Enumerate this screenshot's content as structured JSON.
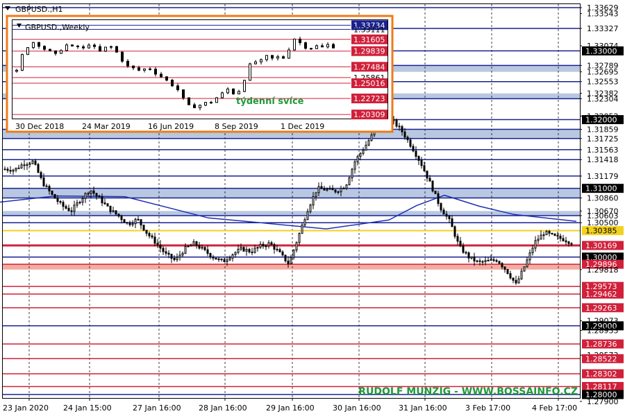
{
  "title": "GBPUSD.,H1",
  "watermark": "RUDOLF MUNZIG - WWW.BOSSAINFO.CZ",
  "colors": {
    "background": "#ffffff",
    "frame": "#000000",
    "ma": "#1f2fb4",
    "candle_up": "#ffffff",
    "candle_down": "#000000",
    "bg_zone": "#b8c8e0",
    "red_zone": "#f4aca0",
    "watermark": "#1e9a3a",
    "inset_border": "#f07a18"
  },
  "price_axis": {
    "min": 1.2795,
    "max": 1.3368,
    "tick_labels": [
      "1.33629",
      "1.33543",
      "1.33327",
      "1.33074",
      "1.33000",
      "1.32789",
      "1.32695",
      "1.32553",
      "1.32382",
      "1.32304",
      "1.32052",
      "1.32000",
      "1.31859",
      "1.31725",
      "1.31563",
      "1.31418",
      "1.31179",
      "1.31000",
      "1.30860",
      "1.30670",
      "1.30603",
      "1.30500",
      "1.30385",
      "1.30169",
      "1.30000",
      "1.29896",
      "1.29818",
      "1.29573",
      "1.29462",
      "1.29263",
      "1.29073",
      "1.29000",
      "1.28933",
      "1.28736",
      "1.28573",
      "1.28522",
      "1.28302",
      "1.28117",
      "1.28000",
      "1.27900"
    ]
  },
  "time_axis": {
    "labels": [
      "23 Jan 2020",
      "24 Jan 15:00",
      "27 Jan 16:00",
      "28 Jan 16:00",
      "29 Jan 16:00",
      "30 Jan 16:00",
      "31 Jan 16:00",
      "3 Feb 17:00",
      "4 Feb 17:00"
    ]
  },
  "chart_data": {
    "type": "candlestick",
    "symbol": "GBPUSD.",
    "timeframe": "H1",
    "ylim": [
      1.2795,
      1.3368
    ],
    "x_labels": [
      "23 Jan 2020",
      "24 Jan 15:00",
      "27 Jan 16:00",
      "28 Jan 16:00",
      "29 Jan 16:00",
      "30 Jan 16:00",
      "31 Jan 16:00",
      "3 Feb 17:00",
      "4 Feb 17:00"
    ],
    "price_path": [
      1.3128,
      1.3127,
      1.3136,
      1.3139,
      1.3108,
      1.309,
      1.3075,
      1.3067,
      1.3084,
      1.3098,
      1.3085,
      1.307,
      1.306,
      1.3048,
      1.3055,
      1.3035,
      1.302,
      1.3004,
      1.2995,
      1.3012,
      1.302,
      1.301,
      1.3,
      1.2993,
      1.3004,
      1.3012,
      1.3008,
      1.3016,
      1.302,
      1.3006,
      1.299,
      1.303,
      1.307,
      1.31,
      1.3098,
      1.3096,
      1.3104,
      1.314,
      1.316,
      1.3182,
      1.32,
      1.3198,
      1.3182,
      1.316,
      1.3135,
      1.3105,
      1.3072,
      1.3052,
      1.3015,
      1.3,
      1.2992,
      1.2994,
      1.2996,
      1.298,
      1.296,
      1.299,
      1.3022,
      1.3036,
      1.303,
      1.3026,
      1.302
    ],
    "moving_average": [
      [
        0,
        1.308
      ],
      [
        80,
        1.3089
      ],
      [
        180,
        1.3088
      ],
      [
        300,
        1.3057
      ],
      [
        470,
        1.3041
      ],
      [
        560,
        1.3054
      ],
      [
        600,
        1.3075
      ],
      [
        640,
        1.309
      ],
      [
        690,
        1.3074
      ],
      [
        740,
        1.3062
      ],
      [
        830,
        1.3052
      ]
    ],
    "zones": [
      {
        "from": 1.32695,
        "to": 1.32789,
        "color": "bg_zone"
      },
      {
        "from": 1.32304,
        "to": 1.32382,
        "color": "bg_zone"
      },
      {
        "from": 1.31725,
        "to": 1.31859,
        "color": "bg_zone"
      },
      {
        "from": 1.3086,
        "to": 1.31,
        "color": "bg_zone"
      },
      {
        "from": 1.30603,
        "to": 1.3067,
        "color": "bg_zone"
      },
      {
        "from": 1.29818,
        "to": 1.29896,
        "color": "red_zone"
      }
    ],
    "levels": [
      {
        "price": 1.33629,
        "label": "1.33629",
        "color": "#1a2090",
        "badge": false
      },
      {
        "price": 1.33327,
        "label": "1.33327",
        "color": "#1a2090",
        "badge": false
      },
      {
        "price": 1.33,
        "label": "1.33000",
        "color": "#1a2090",
        "badge": true
      },
      {
        "price": 1.32789,
        "label": "1.32789",
        "color": "#1a2090",
        "badge": false
      },
      {
        "price": 1.32553,
        "label": "1.32553",
        "color": "#1a2090",
        "badge": false
      },
      {
        "price": 1.32304,
        "label": "1.32304",
        "color": "#1a2090",
        "badge": false
      },
      {
        "price": 1.32,
        "label": "1.32000",
        "color": "#1a2090",
        "badge": true
      },
      {
        "price": 1.31859,
        "label": "1.31859",
        "color": "#1a2090",
        "badge": false
      },
      {
        "price": 1.31725,
        "label": "1.31725",
        "color": "#1a2090",
        "badge": false
      },
      {
        "price": 1.31563,
        "label": "1.31563",
        "color": "#1a2090",
        "badge": false
      },
      {
        "price": 1.31418,
        "label": "1.31418",
        "color": "#1a2090",
        "badge": false
      },
      {
        "price": 1.31179,
        "label": "1.31179",
        "color": "#1a2090",
        "badge": false
      },
      {
        "price": 1.31,
        "label": "1.31000",
        "color": "#1a2090",
        "badge": true
      },
      {
        "price": 1.3086,
        "label": "1.30860",
        "color": "#1a2090",
        "badge": false
      },
      {
        "price": 1.30603,
        "label": "1.30603",
        "color": "#1a2090",
        "badge": false
      },
      {
        "price": 1.305,
        "label": "1.30500",
        "color": "#1a2090",
        "badge": false
      },
      {
        "price": 1.30385,
        "label": "1.30385",
        "color": "#f3d11f",
        "badge": false
      },
      {
        "price": 1.30169,
        "label": "1.30169",
        "color": "#d0203a",
        "badge": false
      },
      {
        "price": 1.3,
        "label": "1.30000",
        "color": "#1a2090",
        "badge": true
      },
      {
        "price": 1.29896,
        "label": "1.29896",
        "color": "#d0203a",
        "badge": false
      },
      {
        "price": 1.29573,
        "label": "1.29573",
        "color": "#d0203a",
        "badge": false
      },
      {
        "price": 1.29462,
        "label": "1.29462",
        "color": "#d0203a",
        "badge": false
      },
      {
        "price": 1.29263,
        "label": "1.29263",
        "color": "#d0203a",
        "badge": false
      },
      {
        "price": 1.29,
        "label": "1.29000",
        "color": "#1a2090",
        "badge": true
      },
      {
        "price": 1.28736,
        "label": "1.28736",
        "color": "#d0203a",
        "badge": false
      },
      {
        "price": 1.28522,
        "label": "1.28522",
        "color": "#d0203a",
        "badge": false
      },
      {
        "price": 1.28302,
        "label": "1.28302",
        "color": "#d0203a",
        "badge": false
      },
      {
        "price": 1.28117,
        "label": "1.28117",
        "color": "#d0203a",
        "badge": false
      },
      {
        "price": 1.28,
        "label": "1.28000",
        "color": "#1a2090",
        "badge": true
      }
    ],
    "inset": {
      "title": "GBPUSD.,Weekly",
      "annotation": "týdenní svíce",
      "x_labels": [
        "30 Dec 2018",
        "24 Mar 2019",
        "16 Jun 2019",
        "8 Sep 2019",
        "1 Dec 2019"
      ],
      "ylim": [
        1.197,
        1.345
      ],
      "price_path": [
        1.268,
        1.292,
        1.305,
        1.312,
        1.308,
        1.302,
        1.298,
        1.292,
        1.3,
        1.308,
        1.304,
        1.306,
        1.3,
        1.31,
        1.306,
        1.296,
        1.302,
        1.307,
        1.3,
        1.289,
        1.276,
        1.274,
        1.27,
        1.269,
        1.275,
        1.268,
        1.262,
        1.258,
        1.25,
        1.245,
        1.236,
        1.218,
        1.214,
        1.216,
        1.218,
        1.222,
        1.222,
        1.232,
        1.236,
        1.244,
        1.231,
        1.242,
        1.262,
        1.283,
        1.282,
        1.284,
        1.292,
        1.286,
        1.29,
        1.288,
        1.304,
        1.319,
        1.31,
        1.304,
        1.303,
        1.306,
        1.304,
        1.308,
        1.305
      ],
      "levels": [
        {
          "price": 1.33734,
          "label": "1.33734",
          "color": "#1a2090",
          "badge": true
        },
        {
          "price": 1.33111,
          "label": "1.33111",
          "color": "#1a2090",
          "badge": false
        },
        {
          "price": 1.31605,
          "label": "1.31605",
          "color": "#d0203a",
          "badge": true
        },
        {
          "price": 1.29839,
          "label": "1.29839",
          "color": "#d0203a",
          "badge": true
        },
        {
          "price": 1.27484,
          "label": "1.27484",
          "color": "#d0203a",
          "badge": true
        },
        {
          "price": 1.25861,
          "label": "1.25861",
          "color": "#d0203a",
          "badge": false
        },
        {
          "price": 1.25016,
          "label": "1.25016",
          "color": "#d0203a",
          "badge": true
        },
        {
          "price": 1.22723,
          "label": "1.22723",
          "color": "#d0203a",
          "badge": true
        },
        {
          "price": 1.20309,
          "label": "1.20309",
          "color": "#d0203a",
          "badge": true
        }
      ]
    }
  }
}
